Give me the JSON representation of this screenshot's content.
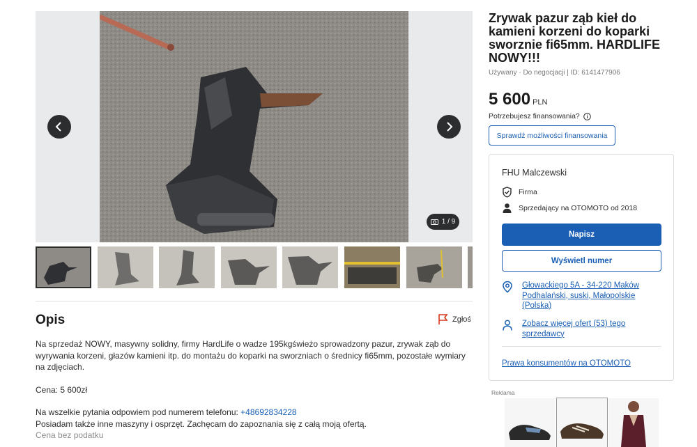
{
  "gallery": {
    "counter": "1 / 9",
    "prev_icon": "chevron-left-icon",
    "next_icon": "chevron-right-icon",
    "camera_icon": "camera-icon"
  },
  "listing": {
    "title": "Zrywak pazur ząb kieł do kamieni korzeni do koparki sworznie fi65mm. HARDLIFE NOWY!!!",
    "meta": "Używany · Do negocjacji | ID: 6141477906",
    "price": "5 600",
    "currency": "PLN",
    "finance_question": "Potrzebujesz finansowania?",
    "finance_button": "Sprawdź możliwości finansowania"
  },
  "seller": {
    "name": "FHU Malczewski",
    "type": "Firma",
    "since": "Sprzedający na OTOMOTO od 2018",
    "write_button": "Napisz",
    "show_number_button": "Wyświetl numer",
    "address": "Głowackiego 5A - 34-220 Maków Podhalański, suski, Małopolskie (Polska)",
    "more_offers": "Zobacz więcej ofert (53) tego sprzedawcy",
    "consumer_rights": "Prawa konsumentów na OTOMOTO"
  },
  "description": {
    "heading": "Opis",
    "report": "Zgłoś",
    "paragraph1": "Na sprzedaż NOWY, masywny solidny, firmy HardLife o wadze 195kgświeżo sprowadzony pazur, zrywak ząb do wyrywania korzeni, głazów kamieni itp. do montażu do koparki na sworzniach o średnicy fi65mm, pozostałe wymiary na zdjęciach.",
    "price_line": "Cena: 5 600zł",
    "contact_prefix": "Na wszelkie pytania odpowiem pod numerem telefonu: ",
    "phone": "+48692834228",
    "line_more": "Posiadam także inne maszyny i osprzęt. Zachęcam do zapoznania się z całą moją ofertą.",
    "line_cut": "Cena bez podatku"
  },
  "ad": {
    "label": "Reklama"
  },
  "colors": {
    "accent": "#1a5fb4",
    "dark": "#2b2d2f",
    "report_flag": "#d9381e"
  }
}
